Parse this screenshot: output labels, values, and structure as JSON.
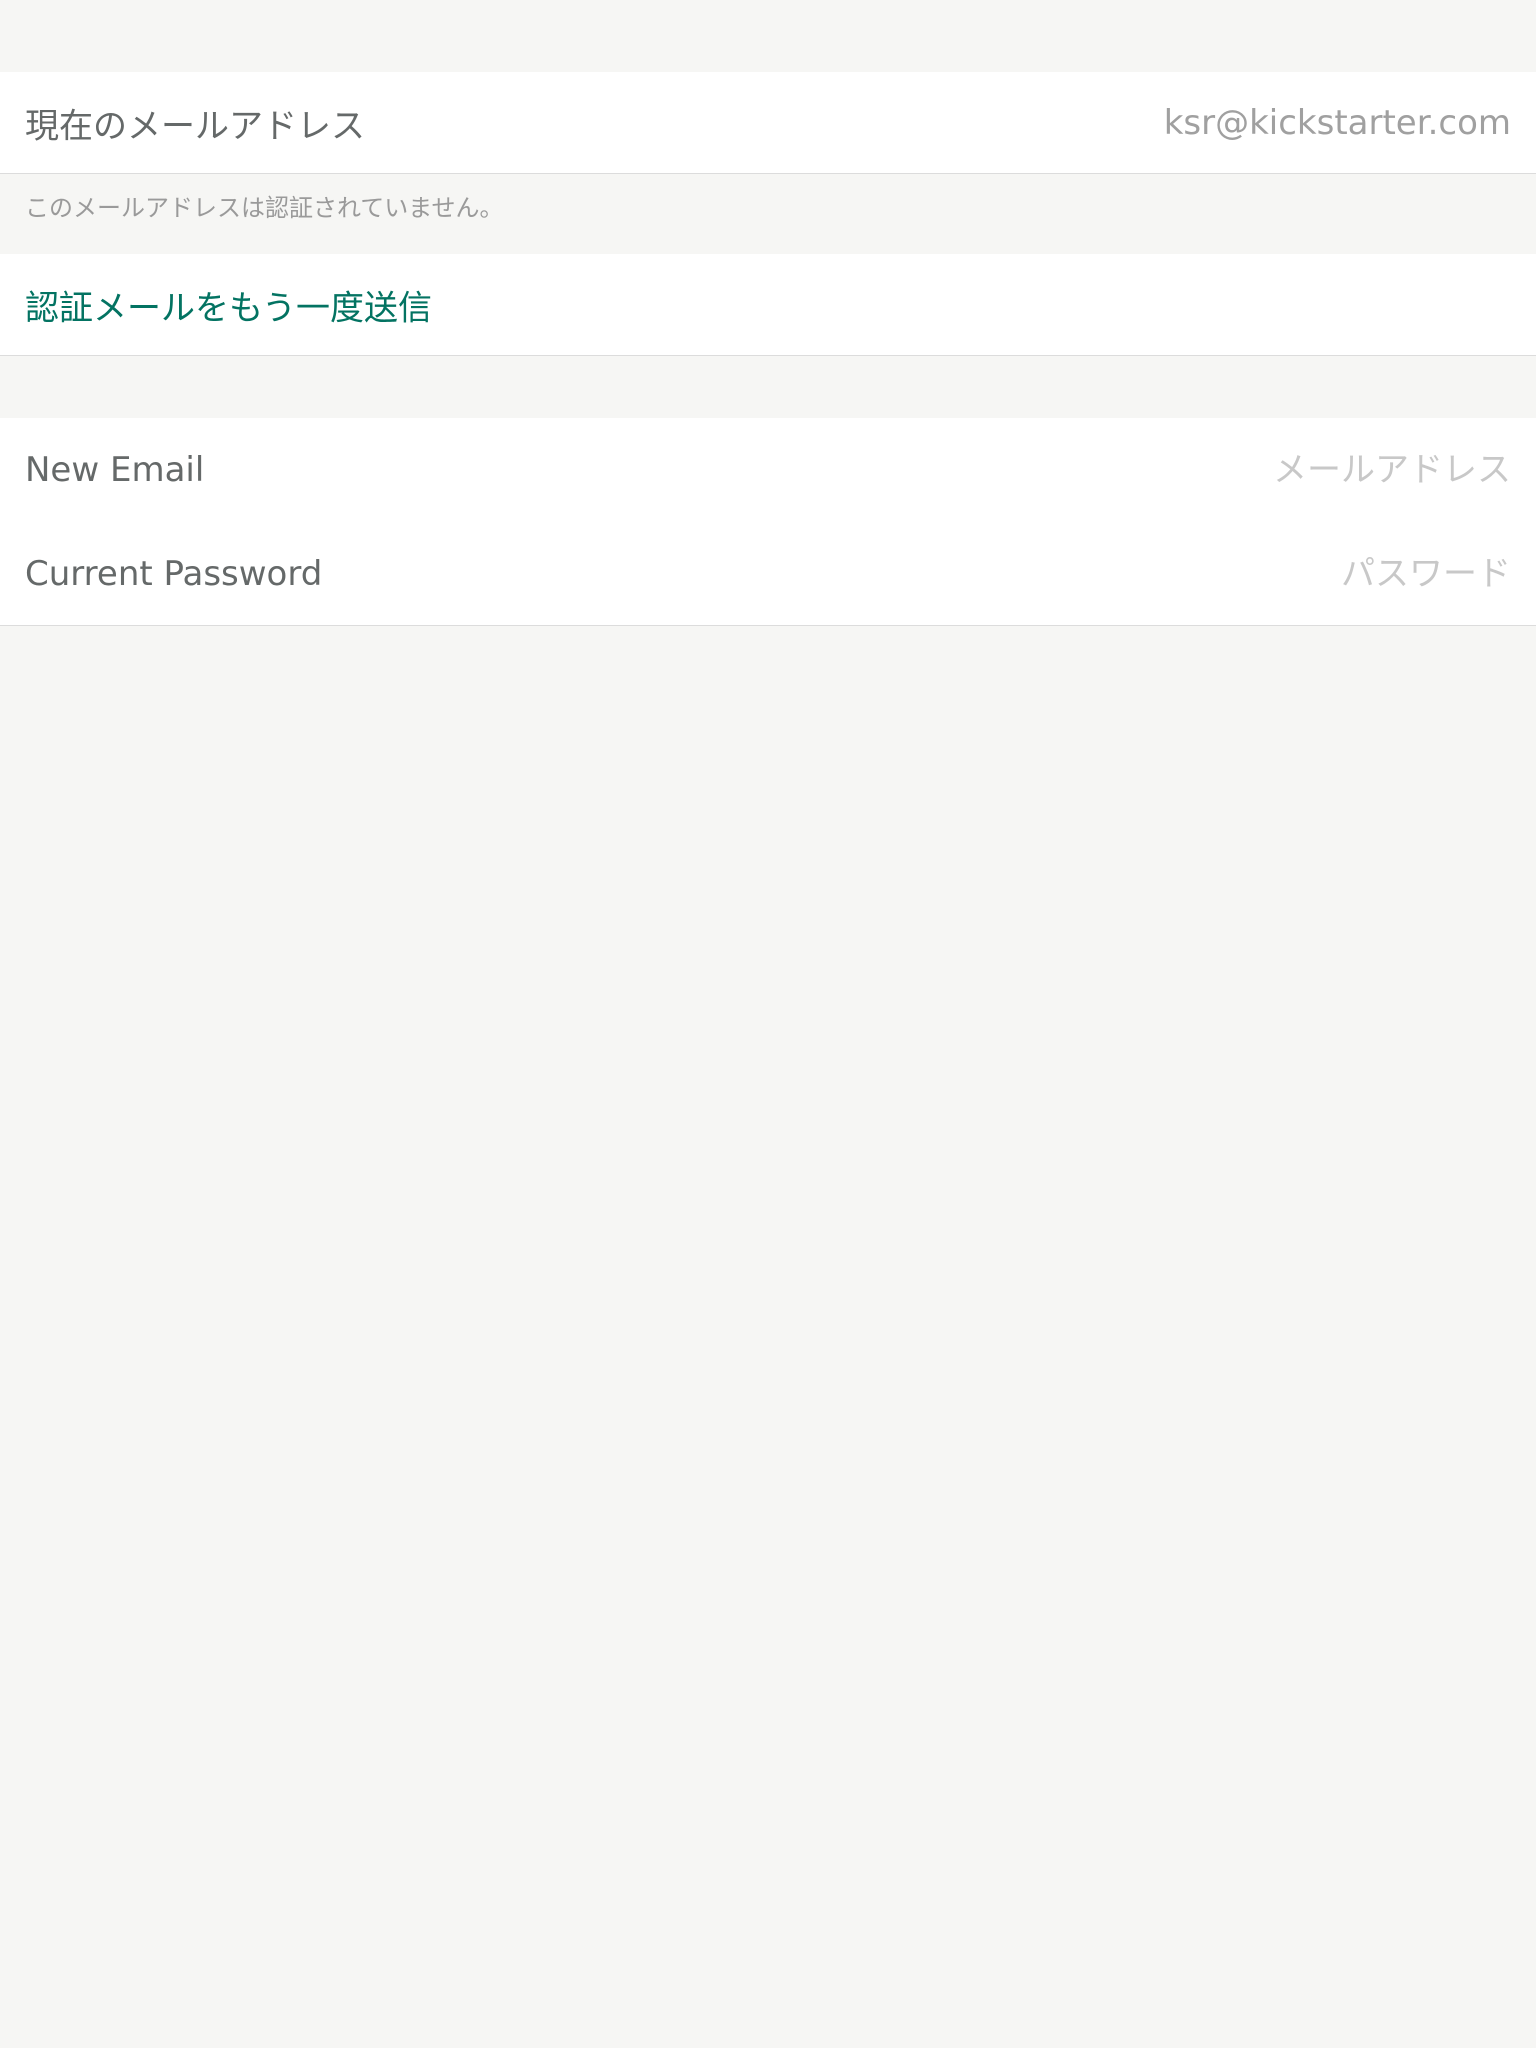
{
  "current_email": {
    "label": "現在のメールアドレス",
    "value": "ksr@kickstarter.com"
  },
  "unverified_note": "このメールアドレスは認証されていません。",
  "resend_link": "認証メールをもう一度送信",
  "change_email_form": {
    "new_email": {
      "label": "New Email",
      "placeholder": "メールアドレス",
      "value": ""
    },
    "current_password": {
      "label": "Current Password",
      "placeholder": "パスワード",
      "value": ""
    }
  },
  "colors": {
    "background": "#f6f6f4",
    "link": "#037362",
    "label": "#656969"
  }
}
